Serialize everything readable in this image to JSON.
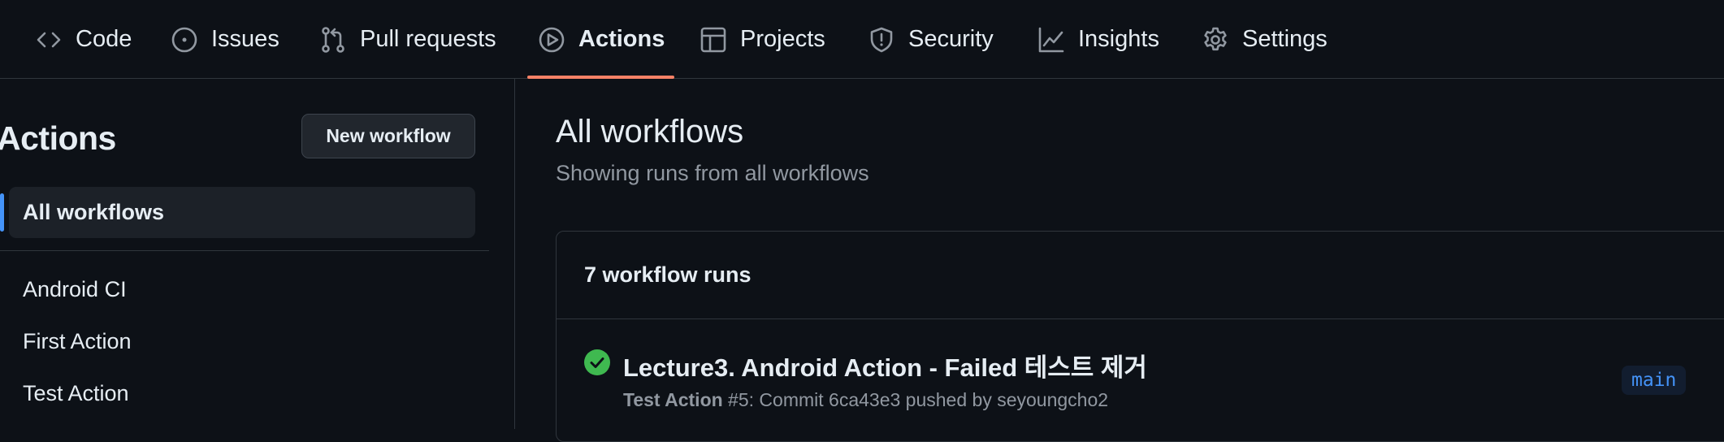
{
  "tabs": [
    {
      "label": "Code",
      "icon": "code-icon"
    },
    {
      "label": "Issues",
      "icon": "issue-opened-icon"
    },
    {
      "label": "Pull requests",
      "icon": "git-pull-request-icon"
    },
    {
      "label": "Actions",
      "icon": "play-icon",
      "active": true
    },
    {
      "label": "Projects",
      "icon": "table-icon"
    },
    {
      "label": "Security",
      "icon": "shield-icon"
    },
    {
      "label": "Insights",
      "icon": "graph-icon"
    },
    {
      "label": "Settings",
      "icon": "gear-icon"
    }
  ],
  "colors": {
    "background": "#0d1117",
    "active_tab_underline": "#f78166",
    "selected_indicator": "#4493f8",
    "success": "#3fb950",
    "branch_text": "#4493f8"
  },
  "sidebar": {
    "title": "Actions",
    "new_workflow_label": "New workflow",
    "all_workflows_label": "All workflows",
    "workflows": [
      {
        "label": "Android CI"
      },
      {
        "label": "First Action"
      },
      {
        "label": "Test Action"
      }
    ]
  },
  "main": {
    "title": "All workflows",
    "subtitle": "Showing runs from all workflows",
    "runs_count_label": "7 workflow runs",
    "runs": [
      {
        "status": "success",
        "title": "Lecture3. Android Action - Failed 테스트 제거",
        "workflow_name": "Test Action",
        "meta_rest": " #5: Commit 6ca43e3 pushed by seyoungcho2",
        "branch": "main"
      }
    ]
  }
}
